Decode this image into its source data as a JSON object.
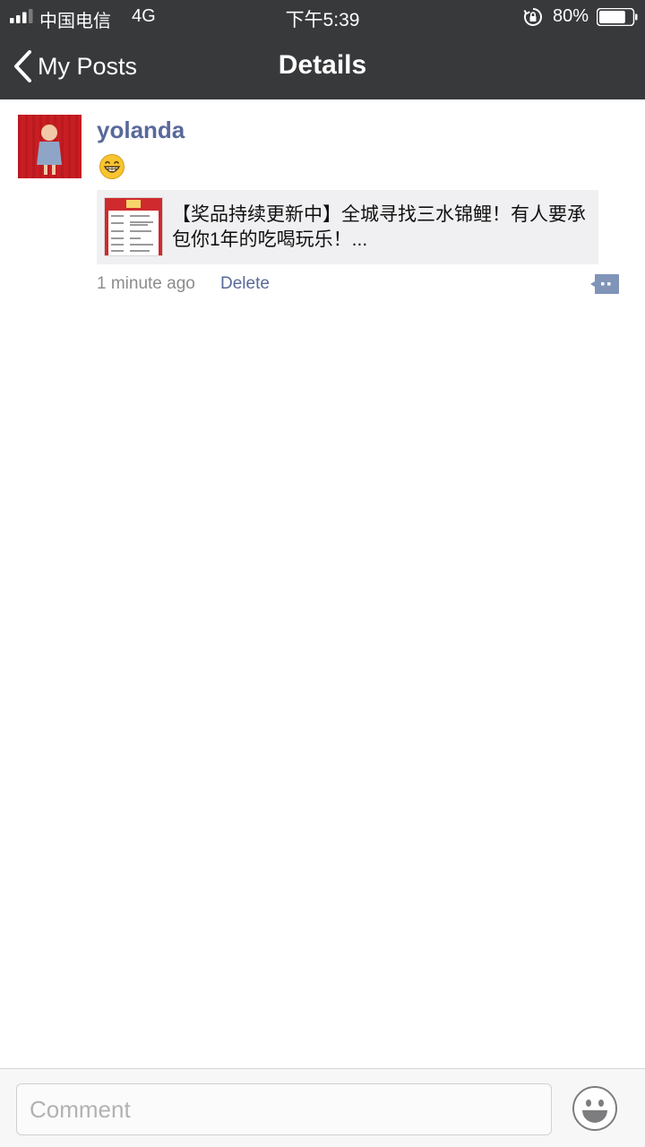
{
  "status_bar": {
    "carrier": "中国电信",
    "network": "4G",
    "time": "下午5:39",
    "battery_percent": "80%",
    "battery_level": 0.8,
    "icons": [
      "signal-icon",
      "orientation-lock-icon",
      "battery-icon"
    ]
  },
  "nav": {
    "back_label": "My Posts",
    "title": "Details",
    "back_icon": "chevron-left-icon"
  },
  "post": {
    "username": "yolanda",
    "emoji": "grinning-face-icon",
    "link": {
      "title": "【奖品持续更新中】全城寻找三水锦鲤！有人要承包你1年的吃喝玩乐！..."
    },
    "timestamp": "1 minute ago",
    "delete_label": "Delete",
    "comment_icon": "comment-bubble-icon"
  },
  "comment_bar": {
    "placeholder": "Comment",
    "emoji_icon": "smiley-icon"
  },
  "colors": {
    "header_bg": "#38393b",
    "link_blue": "#58699a",
    "meta_gray": "#8c8c8c",
    "card_bg": "#f0f0f2"
  }
}
